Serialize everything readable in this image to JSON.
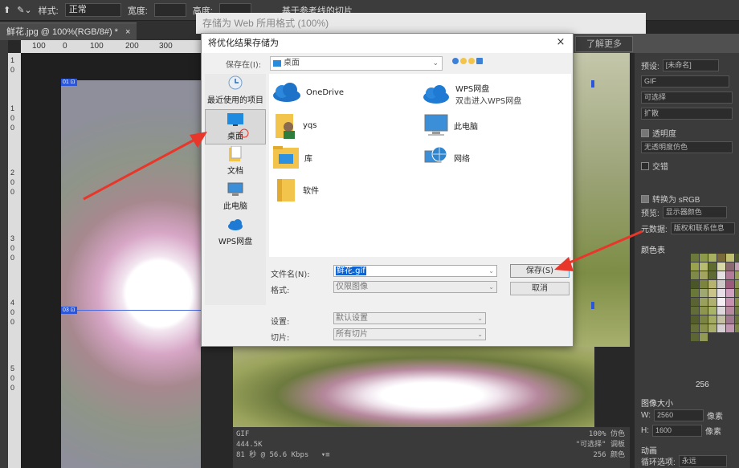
{
  "ps": {
    "style_label": "样式:",
    "style_value": "正常",
    "width_label": "宽度:",
    "height_label": "高度:",
    "slice_guides_label": "基于参考线的切片",
    "doc_tab": "鲜花.jpg @ 100%(RGB/8#) *",
    "doc_tab_close": "×",
    "ruler_h": [
      "100",
      "0",
      "100",
      "200",
      "300"
    ],
    "ruler_v": [
      "1",
      "0",
      "1",
      "0",
      "0",
      "2",
      "0",
      "0",
      "3",
      "0",
      "0",
      "4",
      "0",
      "0",
      "5",
      "0",
      "0"
    ],
    "slice_markers": [
      "01 ⊡",
      "03 ⊡"
    ]
  },
  "save_for_web": {
    "title": "存储为 Web 所用格式 (100%)",
    "learn_more": "了解更多",
    "optimized_info": {
      "format": "GIF",
      "size": "444.5K",
      "speed": "81 秒 @ 56.6 Kbps",
      "menu_arrow": "▾≡",
      "quality": "100% 仿色",
      "palette": "\"可选择\" 调板",
      "colors": "256 颜色"
    },
    "panel": {
      "preset_label": "预设:",
      "preset_value": "[未命名]",
      "format_value": "GIF",
      "reduction_value": "可选择",
      "dither_value": "扩散",
      "transparency_label": "透明度",
      "matte_value": "无透明度仿色",
      "interlaced_label": "交错",
      "convert_srgb_label": "转换为 sRGB",
      "preview_label": "预览:",
      "preview_value": "显示器颜色",
      "metadata_label": "元数据:",
      "metadata_value": "版权和联系信息",
      "color_table_label": "颜色表",
      "color_count": "256",
      "image_size_label": "图像大小",
      "w_label": "W:",
      "w_value": "2560",
      "h_label": "H:",
      "h_value": "1600",
      "pixels_unit": "像素",
      "animation_label": "动画",
      "loop_label": "循环选项:",
      "loop_value": "永远"
    },
    "swatches": [
      "#6b7a3a",
      "#8c9a4a",
      "#a6b060",
      "#7a6a3a",
      "#c0c070",
      "#4e5a2a",
      "#9aa24e",
      "#b8bc70",
      "#5e6c30",
      "#d8d8a8",
      "#8a6a70",
      "#c2a0b2",
      "#7f8a48",
      "#a3a45e",
      "#606a34",
      "#e4e0e4",
      "#b07a98",
      "#969e58",
      "#4a5628",
      "#7c843e",
      "#b6b270",
      "#cfc8c8",
      "#9a5a7a",
      "#88904a",
      "#6a7838",
      "#a0a872",
      "#c8c48a",
      "#e8e0e8",
      "#d0a0c0",
      "#7a823e",
      "#5a6432",
      "#98a05c",
      "#b0b070",
      "#f4eef4",
      "#c890b0",
      "#848c48",
      "#626c36",
      "#8e964e",
      "#aab468",
      "#ded8dc",
      "#b8889e",
      "#727c40",
      "#545e2c",
      "#7c8444",
      "#a4ac62",
      "#c4c0a4",
      "#a07890",
      "#6a7438",
      "#666e38",
      "#88904c",
      "#a8ae6a",
      "#d6d0d4",
      "#c298b0",
      "#7e8646",
      "#5c6632",
      "#929a54"
    ]
  },
  "dialog": {
    "title": "将优化结果存储为",
    "close": "×",
    "save_in_label": "保存在(I):",
    "save_in_value": "桌面",
    "save_in_arrow": "⌄",
    "places": [
      {
        "label": "最近使用的项目"
      },
      {
        "label": "桌面"
      },
      {
        "label": "文档"
      },
      {
        "label": "此电脑"
      },
      {
        "label": "WPS网盘"
      }
    ],
    "items": {
      "onedrive": "OneDrive",
      "wps": "WPS网盘",
      "wps_sub": "双击进入WPS网盘",
      "yqs": "yqs",
      "this_pc": "此电脑",
      "library": "库",
      "network": "网络",
      "software": "软件"
    },
    "filename_label": "文件名(N):",
    "filename_value": "鲜花.gif",
    "format_label": "格式:",
    "format_value": "仅限图像",
    "settings_label": "设置:",
    "settings_value": "默认设置",
    "slices_label": "切片:",
    "slices_value": "所有切片",
    "save_button": "保存(S)",
    "cancel_button": "取消",
    "dropdown_arrow": "⌄"
  },
  "colors": {
    "arrow_red": "#e8362a",
    "selection_blue": "#0a64d3",
    "onedrive_blue": "#1e73c8",
    "folder_yellow": "#f2c44b"
  }
}
